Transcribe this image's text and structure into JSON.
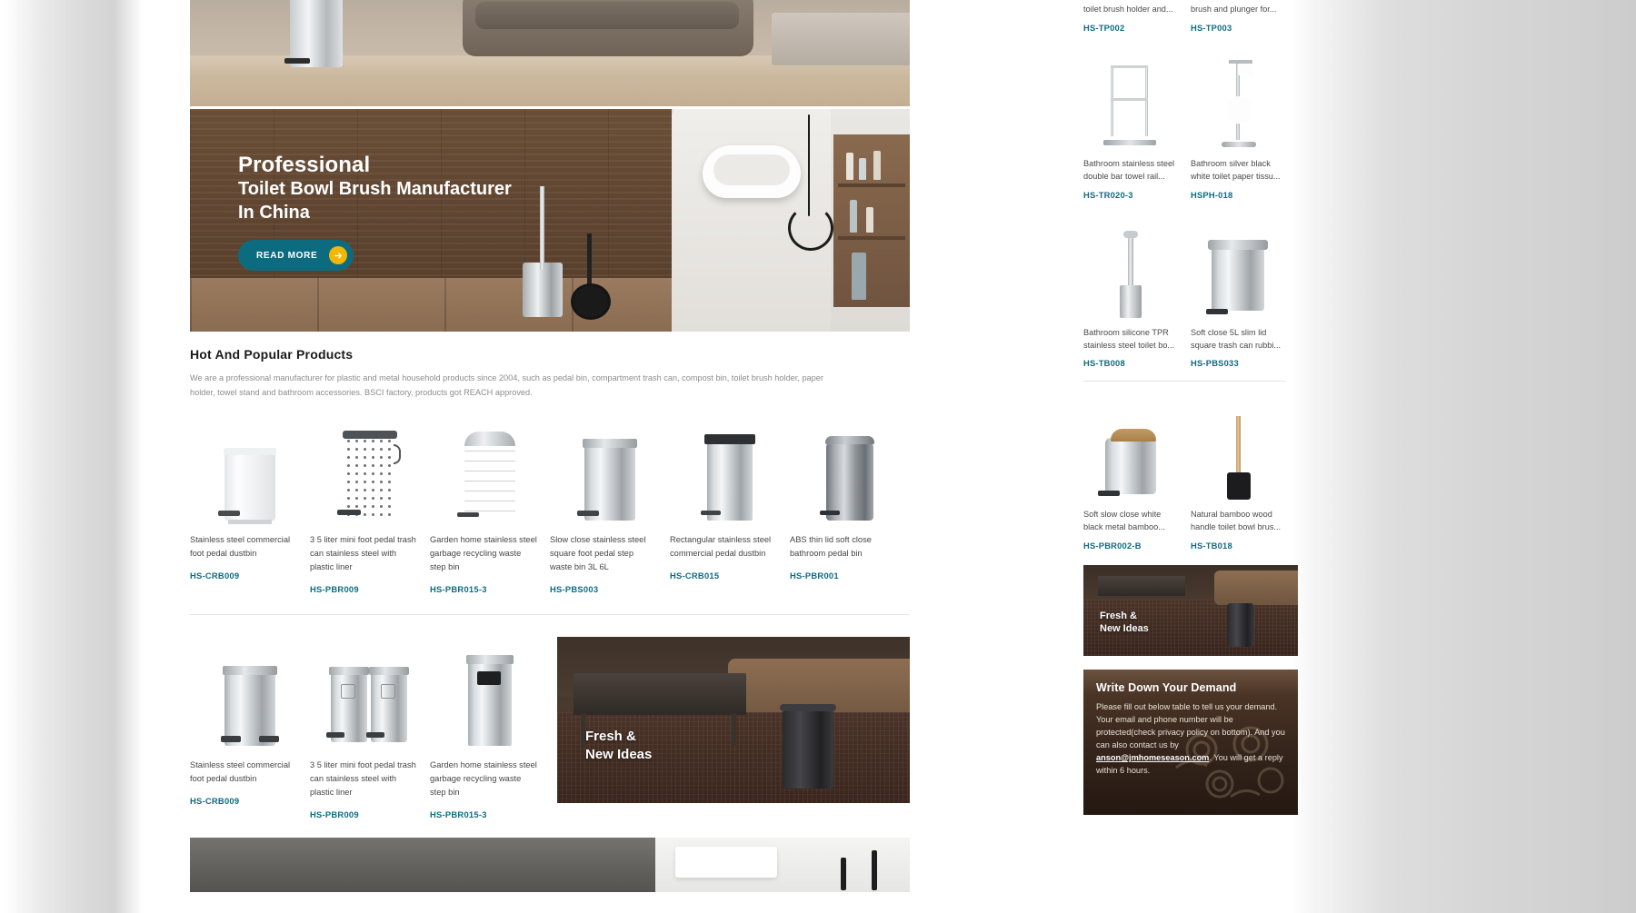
{
  "hero": {
    "title_line1": "Professional",
    "title_line2": "Toilet Bowl Brush Manufacturer",
    "title_line3": "In China",
    "cta_label": "READ MORE",
    "cta_arrow": "arrow-right-icon",
    "cta_bg": "#0d6b80",
    "cta_arrow_bg": "#f2b705"
  },
  "section": {
    "title": "Hot And Popular Products",
    "description": "We are a professional manufacturer for plastic and metal household products since 2004, such as pedal bin, compartment trash can, compost bin, toilet brush holder, paper holder, towel stand and bathroom accessories. BSCI factory, products got REACH approved."
  },
  "products_row1": [
    {
      "name": "Stainless steel commercial foot pedal dustbin",
      "sku": "HS-CRB009"
    },
    {
      "name": "3 5 liter mini foot pedal trash can stainless steel with plastic liner",
      "sku": "HS-PBR009"
    },
    {
      "name": "Garden home stainless steel garbage recycling waste step bin",
      "sku": "HS-PBR015-3"
    },
    {
      "name": "Slow close stainless steel square foot pedal step waste bin 3L 6L",
      "sku": "HS-PBS003"
    },
    {
      "name": "Rectangular stainless steel commercial pedal dustbin",
      "sku": "HS-CRB015"
    },
    {
      "name": "ABS thin lid soft close bathroom pedal bin",
      "sku": "HS-PBR001"
    }
  ],
  "products_row2": [
    {
      "name": "Stainless steel commercial foot pedal dustbin",
      "sku": "HS-CRB009"
    },
    {
      "name": "3 5 liter mini foot pedal trash can stainless steel with plastic liner",
      "sku": "HS-PBR009"
    },
    {
      "name": "Garden home stainless steel garbage recycling waste step bin",
      "sku": "HS-PBR015-3"
    }
  ],
  "promo": {
    "line1": "Fresh &",
    "line2": "New Ideas"
  },
  "sidebar": {
    "partial_top": [
      {
        "name": "toilet brush holder and...",
        "sku": "HS-TP002"
      },
      {
        "name": "brush and plunger for...",
        "sku": "HS-TP003"
      }
    ],
    "products": [
      {
        "name": "Bathroom stainless steel double bar towel rail...",
        "sku": "HS-TR020-3"
      },
      {
        "name": "Bathroom silver black white toilet paper tissu...",
        "sku": "HSPH-018"
      },
      {
        "name": "Bathroom silicone TPR stainless steel toilet bo...",
        "sku": "HS-TB008"
      },
      {
        "name": "Soft close 5L slim lid square trash can rubbi...",
        "sku": "HS-PBS033"
      },
      {
        "name": "Soft slow close white black metal bamboo...",
        "sku": "HS-PBR002-B"
      },
      {
        "name": "Natural bamboo wood handle toilet bowl brus...",
        "sku": "HS-TB018"
      }
    ],
    "promo": {
      "line1": "Fresh &",
      "line2": "New Ideas"
    },
    "form": {
      "title": "Write Down Your Demand",
      "desc_part1": "Please fill out below table to tell us your demand. Your email and phone number will be protected(check privacy policy on bottom). And you can also contact us by ",
      "email": "anson@jmhomeseason.com",
      "desc_part2": ". You will get a reply within 6 hours."
    }
  },
  "colors": {
    "accent_teal": "#0d6b80",
    "accent_yellow": "#f2b705",
    "text_body": "#464646",
    "text_muted": "#8d8d8d"
  }
}
